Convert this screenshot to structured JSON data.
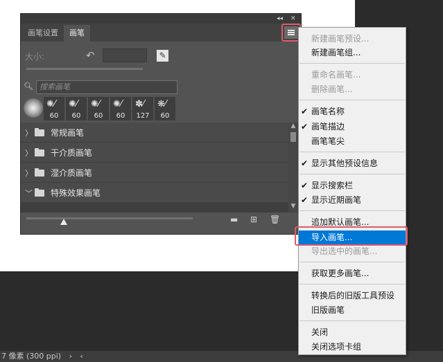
{
  "panel": {
    "tabs": [
      "画笔设置",
      "画笔"
    ],
    "active_tab": 1,
    "size_label": "大小:",
    "search_placeholder": "搜索画笔",
    "presets": [
      {
        "size": ""
      },
      {
        "size": "60"
      },
      {
        "size": "60"
      },
      {
        "size": "60"
      },
      {
        "size": "60"
      },
      {
        "size": "127"
      },
      {
        "size": "60"
      }
    ],
    "groups": [
      {
        "label": "常规画笔",
        "expanded": false
      },
      {
        "label": "干介质画笔",
        "expanded": false
      },
      {
        "label": "湿介质画笔",
        "expanded": false
      },
      {
        "label": "特殊效果画笔",
        "expanded": true
      }
    ],
    "icons": {
      "collapse": "collapse-icon",
      "close": "close-icon",
      "menu": "panel-menu-icon",
      "reset": "reset-size-icon",
      "edit": "brush-edit-icon",
      "search": "search-icon",
      "new_group": "new-folder-icon",
      "new_brush": "new-brush-icon",
      "delete": "trash-icon"
    }
  },
  "menu": {
    "items": [
      {
        "label": "新建画笔预设...",
        "disabled": true,
        "checked": false,
        "selected": false
      },
      {
        "label": "新建画笔组...",
        "disabled": false,
        "checked": false,
        "selected": false
      },
      {
        "label": "重命名画笔...",
        "disabled": true,
        "checked": false,
        "selected": false
      },
      {
        "label": "删除画笔...",
        "disabled": true,
        "checked": false,
        "selected": false
      },
      {
        "label": "画笔名称",
        "disabled": false,
        "checked": true,
        "selected": false
      },
      {
        "label": "画笔描边",
        "disabled": false,
        "checked": true,
        "selected": false
      },
      {
        "label": "画笔笔尖",
        "disabled": false,
        "checked": false,
        "selected": false
      },
      {
        "label": "显示其他预设信息",
        "disabled": false,
        "checked": true,
        "selected": false
      },
      {
        "label": "显示搜索栏",
        "disabled": false,
        "checked": true,
        "selected": false
      },
      {
        "label": "显示近期画笔",
        "disabled": false,
        "checked": true,
        "selected": false
      },
      {
        "label": "追加默认画笔...",
        "disabled": false,
        "checked": false,
        "selected": false
      },
      {
        "label": "导入画笔...",
        "disabled": false,
        "checked": false,
        "selected": true
      },
      {
        "label": "导出选中的画笔...",
        "disabled": true,
        "checked": false,
        "selected": false
      },
      {
        "label": "获取更多画笔...",
        "disabled": false,
        "checked": false,
        "selected": false
      },
      {
        "label": "转换后的旧版工具预设",
        "disabled": false,
        "checked": false,
        "selected": false
      },
      {
        "label": "旧版画笔",
        "disabled": false,
        "checked": false,
        "selected": false
      },
      {
        "label": "关闭",
        "disabled": false,
        "checked": false,
        "selected": false
      },
      {
        "label": "关闭选项卡组",
        "disabled": false,
        "checked": false,
        "selected": false
      }
    ],
    "check_glyph": "✔"
  },
  "status_bar": {
    "text": "7 像素 (300 ppi)",
    "arrow": "›",
    "arrow_left": "‹"
  },
  "colors": {
    "panel_bg": "#535353",
    "menu_bg": "#f0f0f0",
    "selection": "#0078d7",
    "highlight_box": "#e25a6a"
  }
}
